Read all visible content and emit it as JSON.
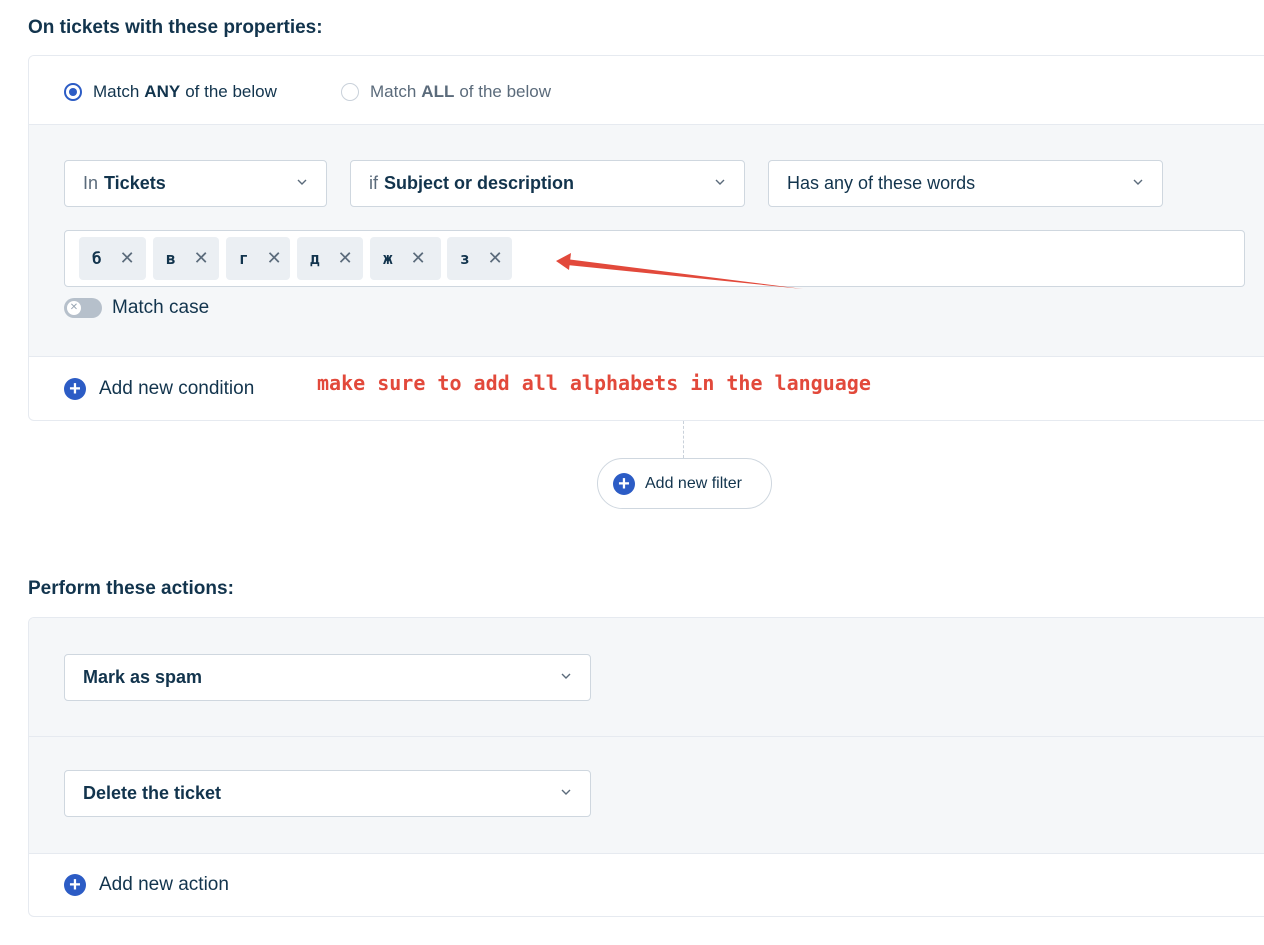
{
  "conditions_section": {
    "title": "On tickets with these properties:",
    "match_any": {
      "prefix": "Match",
      "keyword": "ANY",
      "suffix": "of the below",
      "selected": true
    },
    "match_all": {
      "prefix": "Match",
      "keyword": "ALL",
      "suffix": "of the below",
      "selected": false
    },
    "condition": {
      "in_select": {
        "prefix": "In",
        "value": "Tickets"
      },
      "field_select": {
        "prefix": "if",
        "value": "Subject or description"
      },
      "operator_select": {
        "value": "Has any of these words"
      },
      "tags": [
        "б",
        "в",
        "г",
        "д",
        "ж",
        "з"
      ],
      "remove_symbol": "✕",
      "match_case": {
        "label": "Match case",
        "enabled": false
      }
    },
    "annotation": "make sure to add all alphabets in the language",
    "add_condition_label": "Add new condition"
  },
  "add_filter_label": "Add new filter",
  "actions_section": {
    "title": "Perform these actions:",
    "actions": [
      {
        "value": "Mark as spam"
      },
      {
        "value": "Delete the ticket"
      }
    ],
    "add_action_label": "Add new action"
  },
  "colors": {
    "accent": "#2c5cc5",
    "annotation": "#e2493b",
    "text": "#12344d",
    "panel_bg": "#f5f7f9"
  },
  "icons": {
    "select_caret": "chevron-down-icon",
    "add": "plus-circle-icon",
    "remove_tag": "close-icon",
    "toggle_off": "x-icon"
  }
}
